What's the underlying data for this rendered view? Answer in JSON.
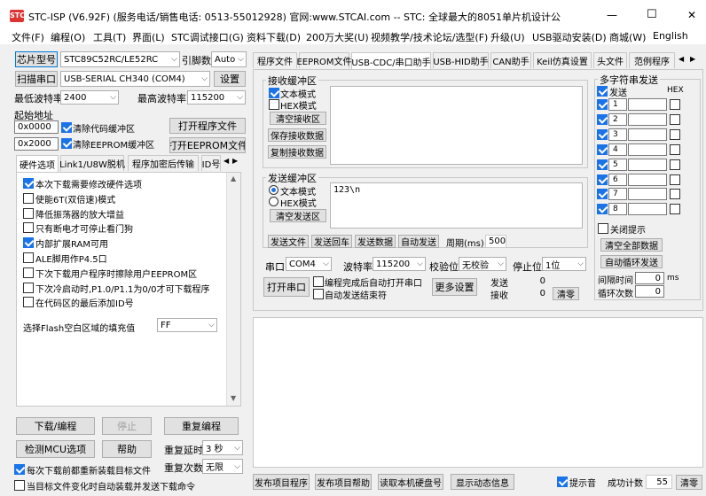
{
  "window": {
    "title": "STC-ISP (V6.92F) (服务电话/销售电话: 0513-55012928) 官网:www.STCAI.com  -- STC: 全球最大的8051单片机设计公司 (姚永平)",
    "min": "—",
    "max": "☐",
    "close": "✕"
  },
  "menu": [
    "文件(F)",
    "编程(O)",
    "工具(T)",
    "界面(L)",
    "STC调试接口(G)",
    "资料下载(D)",
    "200万大奖(U)",
    "视频教学/技术论坛/选型(F)",
    "升级(U)",
    "USB驱动安装(D)",
    "商城(W)",
    "English"
  ],
  "left": {
    "chip_btn": "芯片型号",
    "chip_value": "STC89C52RC/LE52RC",
    "pin_label": "引脚数",
    "pin_value": "Auto",
    "scan_btn": "扫描串口",
    "port_value": "USB-SERIAL CH340 (COM4)",
    "settings_btn": "设置",
    "min_baud_label": "最低波特率",
    "min_baud": "2400",
    "max_baud_label": "最高波特率",
    "max_baud": "115200",
    "start_addr_label": "起始地址",
    "addr1": "0x0000",
    "clear_code": "清除代码缓冲区",
    "open_prog": "打开程序文件",
    "addr2": "0x2000",
    "clear_eeprom": "清除EEPROM缓冲区",
    "open_eeprom": "打开EEPROM文件",
    "tabs": [
      "硬件选项",
      "Link1/U8W脱机",
      "程序加密后传输",
      "ID号"
    ],
    "options": [
      {
        "label": "本次下载需要修改硬件选项",
        "checked": true
      },
      {
        "label": "使能6T(双倍速)模式",
        "checked": false
      },
      {
        "label": "降低振荡器的放大增益",
        "checked": false
      },
      {
        "label": "只有断电才可停止看门狗",
        "checked": false
      },
      {
        "label": "内部扩展RAM可用",
        "checked": true
      },
      {
        "label": "ALE脚用作P4.5口",
        "checked": false
      },
      {
        "label": "下次下载用户程序时擦除用户EEPROM区",
        "checked": false
      },
      {
        "label": "下次冷启动时,P1.0/P1.1为0/0才可下载程序",
        "checked": false
      },
      {
        "label": "在代码区的最后添加ID号",
        "checked": false
      }
    ],
    "fill_label": "选择Flash空白区域的填充值",
    "fill_value": "FF",
    "download_btn": "下载/编程",
    "stop_btn": "停止",
    "reprog_btn": "重复编程",
    "detect_btn": "检测MCU选项",
    "help_btn": "帮助",
    "delay_label": "重复延时",
    "delay_value": "3 秒",
    "reload_label": "每次下载前都重新装载目标文件",
    "reload_checked": true,
    "count_label": "重复次数",
    "count_value": "无限",
    "auto_label": "当目标文件变化时自动装载并发送下载命令",
    "auto_checked": false
  },
  "right": {
    "tabs": [
      "程序文件",
      "EEPROM文件",
      "USB-CDC/串口助手",
      "USB-HID助手",
      "CAN助手",
      "Keil仿真设置",
      "头文件",
      "范例程序"
    ],
    "recv_group": "接收缓冲区",
    "recv_text": "文本模式",
    "recv_hex": "HEX模式",
    "recv_clear": "清空接收区",
    "recv_save": "保存接收数据",
    "recv_copy": "复制接收数据",
    "send_group": "发送缓冲区",
    "send_text": "文本模式",
    "send_hex": "HEX模式",
    "send_clear": "清空发送区",
    "send_content": "123\\n",
    "send_file": "发送文件",
    "send_enter": "发送回车",
    "send_data": "发送数据",
    "auto_send": "自动发送",
    "period_label": "周期(ms)",
    "period_value": "500",
    "port_label": "串口",
    "port_value": "COM4",
    "baud_label": "波特率",
    "baud_value": "115200",
    "parity_label": "校验位",
    "parity_value": "无校验",
    "stop_label": "停止位",
    "stop_value": "1位",
    "open_port": "打开串口",
    "auto_open": "编程完成后自动打开串口",
    "auto_end": "自动发送结束符",
    "more": "更多设置",
    "sent_label": "发送",
    "sent_value": "0",
    "recv_label": "接收",
    "recv_value": "0",
    "zero_btn": "清零",
    "multi_group": "多字符串发送",
    "multi_send": "发送",
    "multi_hex": "HEX",
    "multi_rows": [
      "1",
      "2",
      "3",
      "4",
      "5",
      "6",
      "7",
      "8"
    ],
    "close_tip": "关闭提示",
    "clear_all": "清空全部数据",
    "auto_loop": "自动循环发送",
    "interval_label": "间隔时间",
    "interval_value": "0",
    "interval_unit": "ms",
    "loop_label": "循环次数",
    "loop_value": "0"
  },
  "bottom": {
    "publish": "发布项目程序",
    "publish_help": "发布项目帮助",
    "read_disk": "读取本机硬盘号",
    "show_anim": "显示动态信息",
    "beep_label": "提示音",
    "beep_checked": true,
    "success_label": "成功计数",
    "success_value": "55",
    "zero_btn": "清零"
  }
}
